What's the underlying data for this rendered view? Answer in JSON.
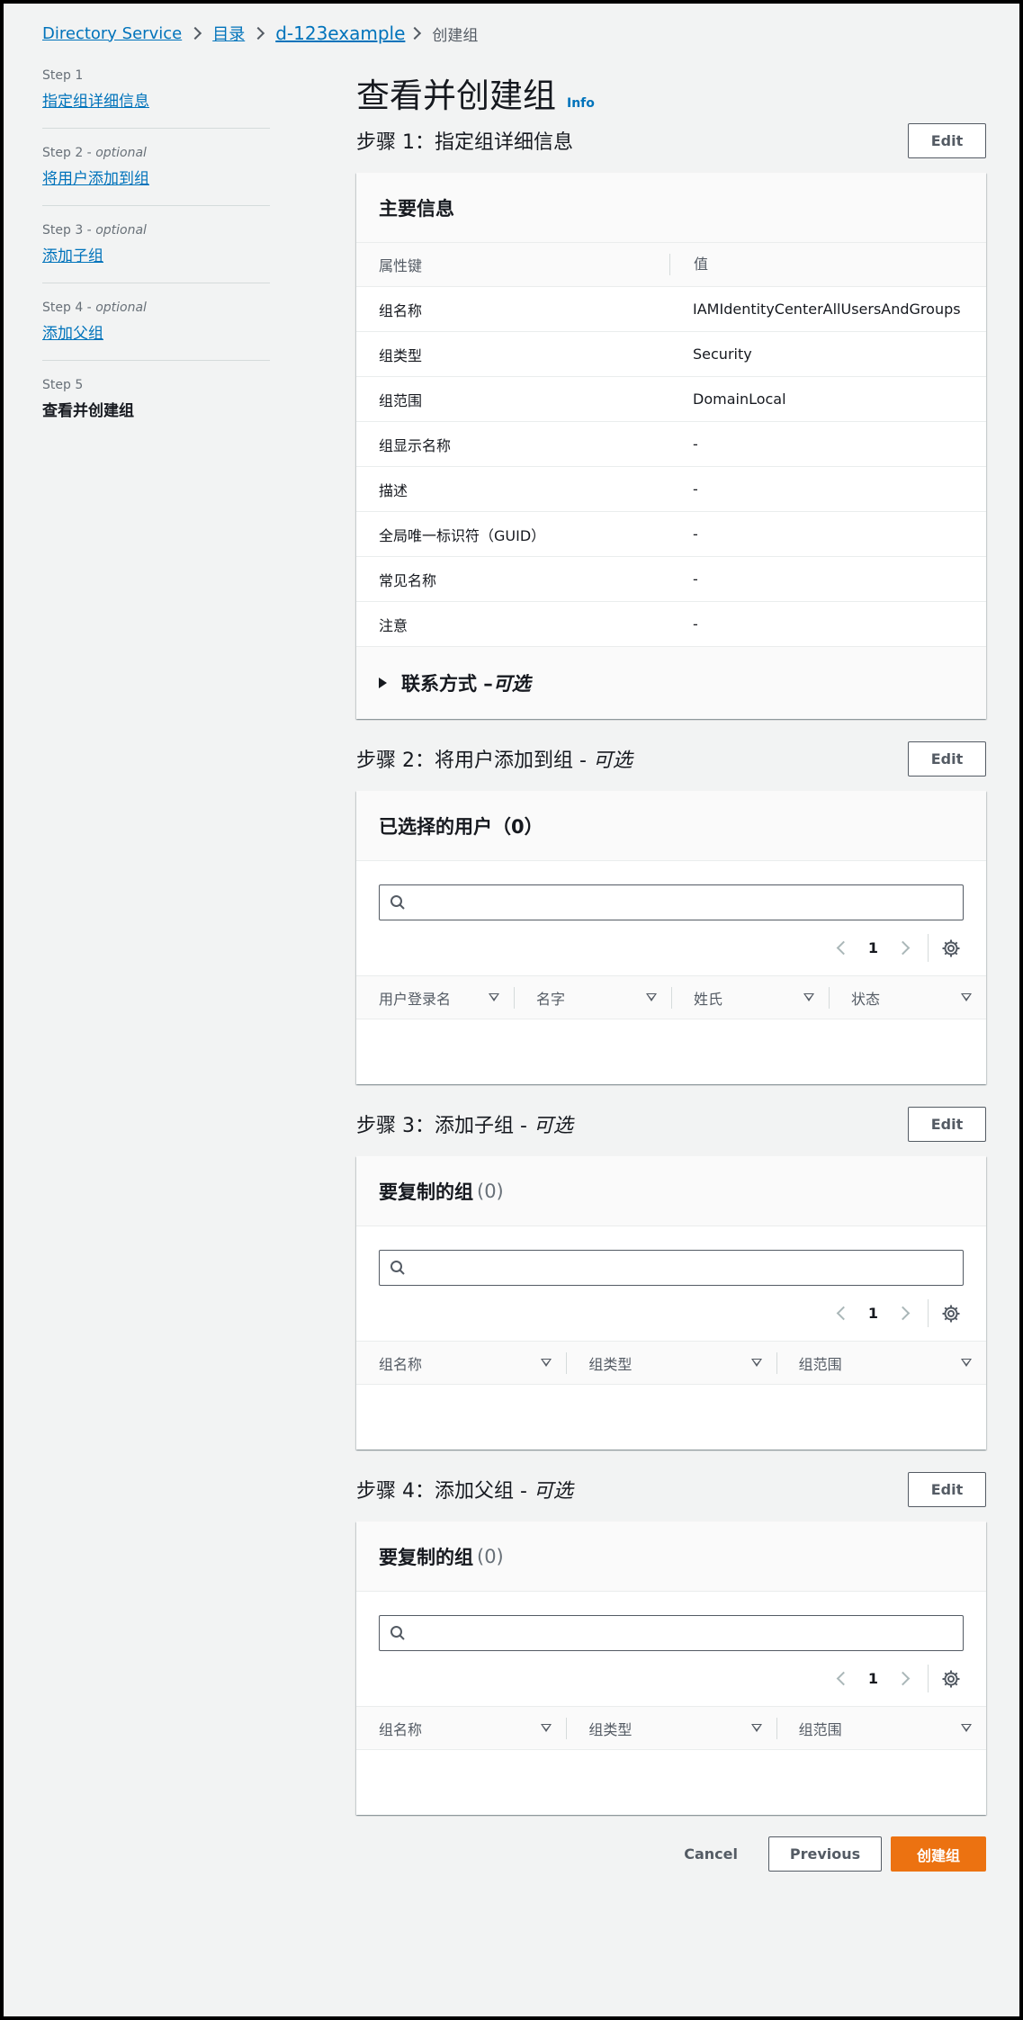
{
  "breadcrumb": {
    "items": [
      "Directory Service",
      "目录",
      "d-123example"
    ],
    "current": "创建组"
  },
  "steps": [
    {
      "num": "Step 1",
      "optional": "",
      "title": "指定组详细信息"
    },
    {
      "num": "Step 2",
      "optional": "optional",
      "title": "将用户添加到组"
    },
    {
      "num": "Step 3",
      "optional": "optional",
      "title": "添加子组"
    },
    {
      "num": "Step 4",
      "optional": "optional",
      "title": "添加父组"
    },
    {
      "num": "Step 5",
      "optional": "",
      "title": "查看并创建组"
    }
  ],
  "page": {
    "title": "查看并创建组",
    "info": "Info"
  },
  "edit_label": "Edit",
  "section1": {
    "heading": "步骤 1：指定组详细信息",
    "card_title": "主要信息",
    "col_key": "属性键",
    "col_value": "值",
    "rows": [
      {
        "k": "组名称",
        "v": "IAMIdentityCenterAllUsersAndGroups"
      },
      {
        "k": "组类型",
        "v": "Security"
      },
      {
        "k": "组范围",
        "v": "DomainLocal"
      },
      {
        "k": "组显示名称",
        "v": "-"
      },
      {
        "k": "描述",
        "v": "-"
      },
      {
        "k": "全局唯一标识符（GUID）",
        "v": "-"
      },
      {
        "k": "常见名称",
        "v": "-"
      },
      {
        "k": "注意",
        "v": "-"
      }
    ],
    "expander_label": "联系方式 – ",
    "expander_optional": "可选"
  },
  "section2": {
    "heading": "步骤 2：将用户添加到组 - ",
    "heading_optional": "可选",
    "card_title": "已选择的用户（0）",
    "page": "1",
    "columns": [
      "用户登录名",
      "名字",
      "姓氏",
      "状态"
    ]
  },
  "section3": {
    "heading": "步骤 3：添加子组 - ",
    "heading_optional": "可选",
    "card_title": "要复制的组",
    "count": "(0)",
    "page": "1",
    "columns": [
      "组名称",
      "组类型",
      "组范围"
    ]
  },
  "section4": {
    "heading": "步骤 4：添加父组 - ",
    "heading_optional": "可选",
    "card_title": "要复制的组",
    "count": "(0)",
    "page": "1",
    "columns": [
      "组名称",
      "组类型",
      "组范围"
    ]
  },
  "footer": {
    "cancel": "Cancel",
    "previous": "Previous",
    "create": "创建组"
  },
  "colors": {
    "link": "#0073bb",
    "primary": "#ec7211",
    "background": "#f2f3f3"
  },
  "icons": [
    "chevron-right-icon",
    "search-icon",
    "chevron-left-icon",
    "gear-icon",
    "sort-icon",
    "caret-right-icon"
  ]
}
